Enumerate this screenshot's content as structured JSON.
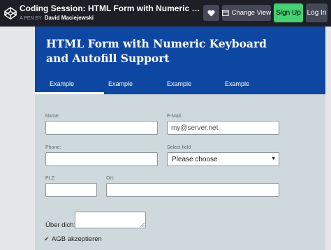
{
  "header": {
    "title": "Coding Session: HTML Form with Numeric Keyboard and Autofill Support",
    "byline_prefix": "A PEN BY",
    "author": "David Maciejewski",
    "change_view_label": "Change View",
    "signup_label": "Sign Up",
    "login_label": "Log In"
  },
  "hero": {
    "title": "HTML Form with Numeric Keyboard and Autofill Support",
    "tabs": [
      "Example",
      "Example",
      "Example",
      "Example"
    ],
    "active_tab": 0
  },
  "form": {
    "name_label": "Name:",
    "name_value": "",
    "email_label": "E-Mail:",
    "email_placeholder": "my@server.net",
    "phone_label": "Phone:",
    "phone_value": "",
    "select_label": "Select field",
    "select_value": "Please choose",
    "plz_label": "PLZ:",
    "plz_value": "",
    "ort_label": "Ort:",
    "ort_value": "",
    "about_label": "Über dich:",
    "agb_label": "AGB akzeptieren",
    "agb_checked": true
  },
  "colors": {
    "topbar": "#1e1f26",
    "hero": "#0d47a1",
    "form_bg": "#cfd8dc",
    "signup": "#47cf73",
    "button": "#444857"
  }
}
